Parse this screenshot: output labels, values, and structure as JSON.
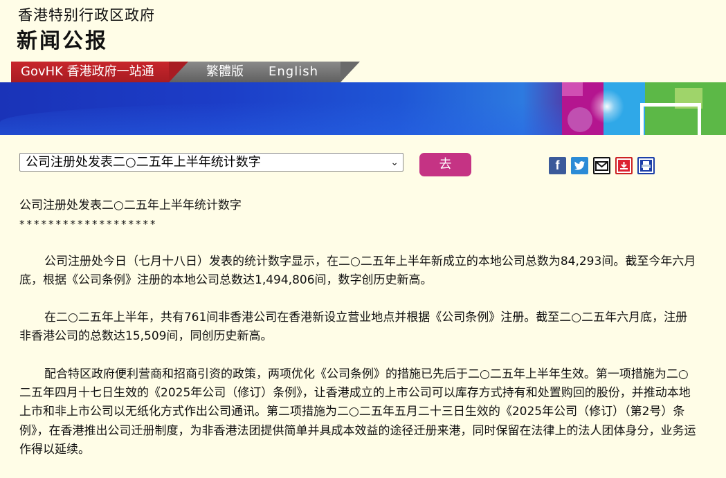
{
  "header": {
    "gov_name": "香港特别行政区政府",
    "site_name": "新闻公报"
  },
  "nav": {
    "govhk": "GovHK 香港政府一站通",
    "traditional": "繁體版",
    "english": "English"
  },
  "colors": {
    "govhk_red": "#b2222a",
    "go_button": "#c53384",
    "background": "#fffde7"
  },
  "selector": {
    "selected": "公司注册处发表二○二五年上半年统计数字",
    "go_label": "去"
  },
  "share": {
    "icons": [
      "facebook-icon",
      "twitter-icon",
      "email-icon",
      "download-icon",
      "print-icon"
    ]
  },
  "article": {
    "title": "公司注册处发表二○二五年上半年统计数字",
    "stars": "*******************",
    "paragraphs": [
      "公司注册处今日（七月十八日）发表的统计数字显示，在二○二五年上半年新成立的本地公司总数为84,293间。截至今年六月底，根据《公司条例》注册的本地公司总数达1,494,806间，数字创历史新高。",
      "在二○二五年上半年，共有761间非香港公司在香港新设立营业地点并根据《公司条例》注册。截至二○二五年六月底，注册非香港公司的总数达15,509间，同创历史新高。",
      "配合特区政府便利营商和招商引资的政策，两项优化《公司条例》的措施已先后于二○二五年上半年生效。第一项措施为二○二五年四月十七日生效的《2025年公司（修订）条例》，让香港成立的上市公司可以库存方式持有和处置购回的股份，并推动本地上市和非上市公司以无纸化方式作出公司通讯。第二项措施为二○二五年五月二十三日生效的《2025年公司（修订）（第2号）条例》，在香港推出公司迁册制度，为非香港法团提供简单并具成本效益的途径迁册来港，同时保留在法律上的法人团体身分，业务运作得以延续。"
    ]
  }
}
